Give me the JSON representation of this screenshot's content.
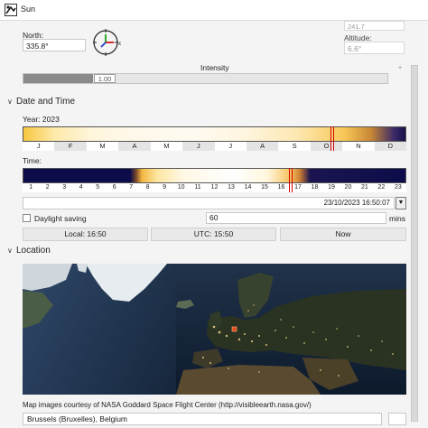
{
  "window": {
    "title": "Sun"
  },
  "north": {
    "label": "North:",
    "value": "335.8°"
  },
  "azimuth": {
    "value": "241.7"
  },
  "altitude": {
    "label": "Altitude:",
    "value": "6.6°"
  },
  "intensity": {
    "label": "Intensity",
    "value": "1.00",
    "fraction": 0.19
  },
  "date_time_section": {
    "title": "Date and Time"
  },
  "year": {
    "label": "Year: 2023",
    "months": [
      "J",
      "F",
      "M",
      "A",
      "M",
      "J",
      "J",
      "A",
      "S",
      "O",
      "N",
      "D"
    ]
  },
  "time": {
    "label": "Time:",
    "hours": [
      "1",
      "2",
      "3",
      "4",
      "5",
      "6",
      "7",
      "8",
      "9",
      "10",
      "11",
      "12",
      "13",
      "14",
      "15",
      "16",
      "17",
      "18",
      "19",
      "20",
      "21",
      "22",
      "23"
    ]
  },
  "datetime": {
    "value": "23/10/2023 16:50:07"
  },
  "daylight_saving": {
    "label": "Daylight saving",
    "checked": false,
    "minutes_value": "60",
    "minutes_unit": "mins"
  },
  "buttons": {
    "local": "Local: 16:50",
    "utc": "UTC: 15:50",
    "now": "Now"
  },
  "location_section": {
    "title": "Location"
  },
  "map": {
    "credit": "Map images courtesy of NASA Goddard Space Flight Center (http://visibleearth.nasa.gov/)"
  },
  "location": {
    "value": "Brussels (Bruxelles), Belgium"
  },
  "colors": {
    "marker": "#d40000",
    "night": "#0c0c4a",
    "day": "#f4b640"
  }
}
